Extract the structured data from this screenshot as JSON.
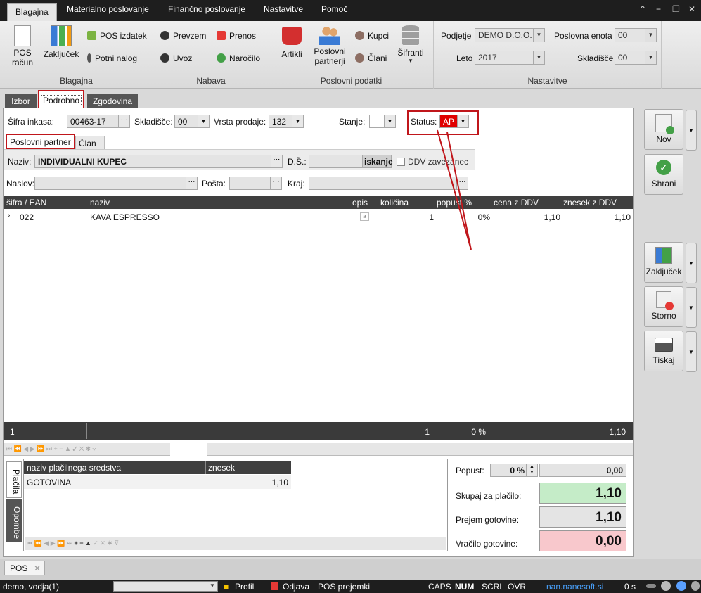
{
  "menu": {
    "tabs": [
      "Blagajna",
      "Materialno poslovanje",
      "Finančno poslovanje",
      "Nastavitve",
      "Pomoč"
    ]
  },
  "ribbon": {
    "blagajna": {
      "caption": "Blagajna",
      "pos_racun": "POS\nračun",
      "zakljucek": "Zaključek",
      "pos_izdatek": "POS izdatek",
      "potni_nalog": "Potni nalog"
    },
    "nabava": {
      "caption": "Nabava",
      "prevzem": "Prevzem",
      "uvoz": "Uvoz",
      "prenos": "Prenos",
      "narocilo": "Naročilo"
    },
    "poslovni": {
      "caption": "Poslovni podatki",
      "artikli": "Artikli",
      "partnerji": "Poslovni\npartnerji",
      "kupci": "Kupci",
      "clani": "Člani",
      "sifranti": "Šifranti"
    },
    "nastavitve": {
      "caption": "Nastavitve",
      "podjetje_label": "Podjetje",
      "podjetje": "DEMO D.O.O.",
      "leto_label": "Leto",
      "leto": "2017",
      "enota_label": "Poslovna enota",
      "enota": "00",
      "skladisce_label": "Skladišče",
      "skladisce": "00"
    }
  },
  "doc_tabs": [
    "Izbor",
    "Podrobno",
    "Zgodovina"
  ],
  "header": {
    "sifra_label": "Šifra inkasa:",
    "sifra": "00463-17",
    "sklad_label": "Skladišče:",
    "sklad": "00",
    "vrsta_label": "Vrsta prodaje:",
    "vrsta": "132",
    "stanje_label": "Stanje:",
    "status_label": "Status:",
    "status": "AP"
  },
  "sub_tabs": [
    "Poslovni partner",
    "Član"
  ],
  "partner": {
    "naziv_label": "Naziv:",
    "naziv": "INDIVIDUALNI KUPEC",
    "ds_label": "D.Š.:",
    "iskanje": "iskanje",
    "ddv": "DDV zavezanec",
    "naslov_label": "Naslov:",
    "posta_label": "Pošta:",
    "kraj_label": "Kraj:"
  },
  "grid": {
    "columns": [
      "šifra / EAN",
      "naziv",
      "opis",
      "količina",
      "popust %",
      "cena z DDV",
      "znesek z DDV"
    ],
    "rows": [
      {
        "sifra": "022",
        "naziv": "KAVA ESPRESSO",
        "kolicina": "1",
        "popust": "0%",
        "cena": "1,10",
        "znesek": "1,10"
      }
    ],
    "footer": {
      "count": "1",
      "kolicina": "1",
      "popust": "0 %",
      "znesek": "1,10"
    }
  },
  "payments": {
    "side_tabs": [
      "Plačila",
      "Opombe"
    ],
    "columns": [
      "naziv plačilnega sredstva",
      "znesek"
    ],
    "rows": [
      {
        "naziv": "GOTOVINA",
        "znesek": "1,10"
      }
    ]
  },
  "totals": {
    "popust_label": "Popust:",
    "popust_pct": "0 %",
    "popust_val": "0,00",
    "skupaj_label": "Skupaj za plačilo:",
    "skupaj": "1,10",
    "prejem_label": "Prejem gotovine:",
    "prejem": "1,10",
    "vracilo_label": "Vračilo gotovine:",
    "vracilo": "0,00"
  },
  "actions": {
    "nov": "Nov",
    "shrani": "Shrani",
    "zakljucek": "Zaključek",
    "storno": "Storno",
    "tiskaj": "Tiskaj"
  },
  "bottom_tab": "POS",
  "status": {
    "user": "demo, vodja(1)",
    "profil": "Profil",
    "odjava": "Odjava",
    "pos_prejemki": "POS prejemki",
    "caps": "CAPS",
    "num": "NUM",
    "scrl": "SCRL",
    "ovr": "OVR",
    "site": "nan.nanosoft.si",
    "time": "0 s"
  }
}
